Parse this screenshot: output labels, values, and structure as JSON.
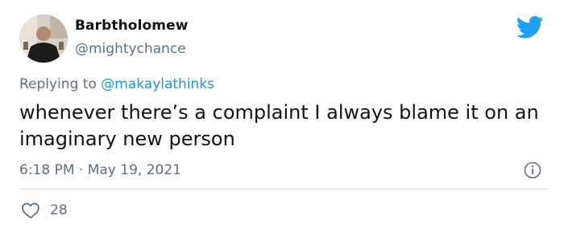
{
  "tweet": {
    "author": {
      "name": "Barbtholomew",
      "handle": "@mightychance"
    },
    "reply": {
      "prefix": "Replying to",
      "mention": "@makaylathinks"
    },
    "text": "whenever there’s a complaint I always blame it on an imaginary new person",
    "time": "6:18 PM",
    "separator": "·",
    "date": "May 19, 2021",
    "likes": "28"
  },
  "icons": {
    "brand": "twitter-bird-icon",
    "info": "info-icon",
    "like": "heart-icon"
  },
  "colors": {
    "accent": "#1da1f2",
    "mention": "#1b95e0",
    "secondary_text": "#5b7083",
    "primary_text": "#0f1419",
    "divider": "#cfd9de"
  }
}
